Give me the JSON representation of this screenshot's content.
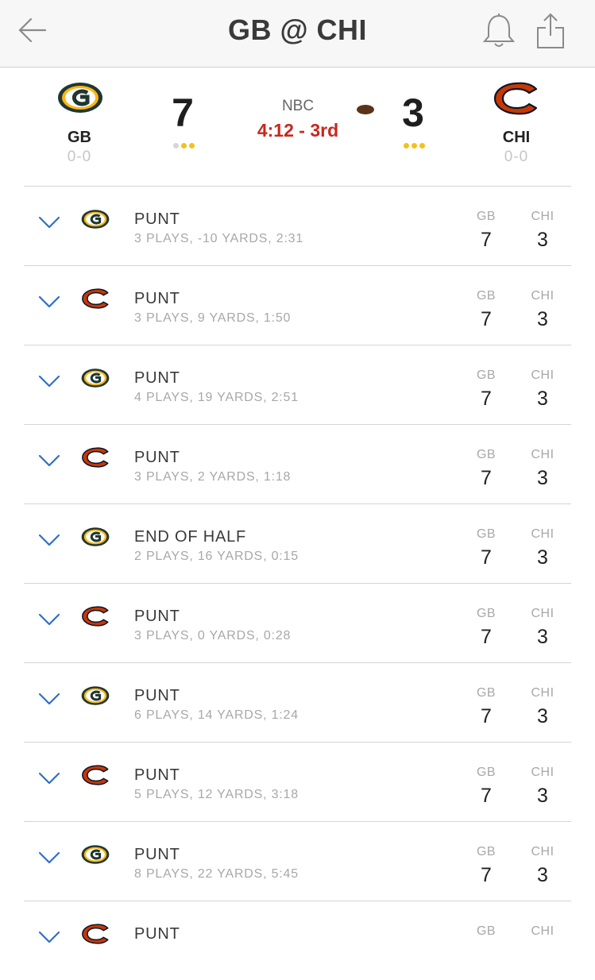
{
  "header": {
    "title": "GB @ CHI",
    "back_icon": "back-arrow-icon",
    "bell_icon": "bell-icon",
    "share_icon": "share-icon"
  },
  "game": {
    "network": "NBC",
    "clock": "4:12 - 3rd",
    "away": {
      "abbr": "GB",
      "score": "7",
      "record": "0-0",
      "timeouts_remaining": 2,
      "logo": "packers-logo-icon"
    },
    "home": {
      "abbr": "CHI",
      "score": "3",
      "record": "0-0",
      "timeouts_remaining": 3,
      "logo": "bears-logo-icon"
    },
    "possession_icon": "football-icon"
  },
  "colors": {
    "clock_red": "#c8281e",
    "timeout_gold": "#f2c21b",
    "timeout_used": "#d6d6d6",
    "chevron_blue": "#2e6fc9",
    "packers_green": "#203731",
    "packers_gold": "#ffb612",
    "bears_orange": "#c83803",
    "bears_navy": "#0b162a"
  },
  "drives": [
    {
      "team": "GB",
      "result": "PUNT",
      "summary": "3 PLAYS, -10 YARDS, 2:31",
      "col1_label": "GB",
      "col2_label": "CHI",
      "col1_score": "7",
      "col2_score": "3"
    },
    {
      "team": "CHI",
      "result": "PUNT",
      "summary": "3 PLAYS, 9 YARDS, 1:50",
      "col1_label": "GB",
      "col2_label": "CHI",
      "col1_score": "7",
      "col2_score": "3"
    },
    {
      "team": "GB",
      "result": "PUNT",
      "summary": "4 PLAYS, 19 YARDS, 2:51",
      "col1_label": "GB",
      "col2_label": "CHI",
      "col1_score": "7",
      "col2_score": "3"
    },
    {
      "team": "CHI",
      "result": "PUNT",
      "summary": "3 PLAYS, 2 YARDS, 1:18",
      "col1_label": "GB",
      "col2_label": "CHI",
      "col1_score": "7",
      "col2_score": "3"
    },
    {
      "team": "GB",
      "result": "END OF HALF",
      "summary": "2 PLAYS, 16 YARDS, 0:15",
      "col1_label": "GB",
      "col2_label": "CHI",
      "col1_score": "7",
      "col2_score": "3"
    },
    {
      "team": "CHI",
      "result": "PUNT",
      "summary": "3 PLAYS, 0 YARDS, 0:28",
      "col1_label": "GB",
      "col2_label": "CHI",
      "col1_score": "7",
      "col2_score": "3"
    },
    {
      "team": "GB",
      "result": "PUNT",
      "summary": "6 PLAYS, 14 YARDS, 1:24",
      "col1_label": "GB",
      "col2_label": "CHI",
      "col1_score": "7",
      "col2_score": "3"
    },
    {
      "team": "CHI",
      "result": "PUNT",
      "summary": "5 PLAYS, 12 YARDS, 3:18",
      "col1_label": "GB",
      "col2_label": "CHI",
      "col1_score": "7",
      "col2_score": "3"
    },
    {
      "team": "GB",
      "result": "PUNT",
      "summary": "8 PLAYS, 22 YARDS, 5:45",
      "col1_label": "GB",
      "col2_label": "CHI",
      "col1_score": "7",
      "col2_score": "3"
    },
    {
      "team": "CHI",
      "result": "PUNT",
      "summary": "",
      "col1_label": "GB",
      "col2_label": "CHI",
      "col1_score": "",
      "col2_score": ""
    }
  ]
}
